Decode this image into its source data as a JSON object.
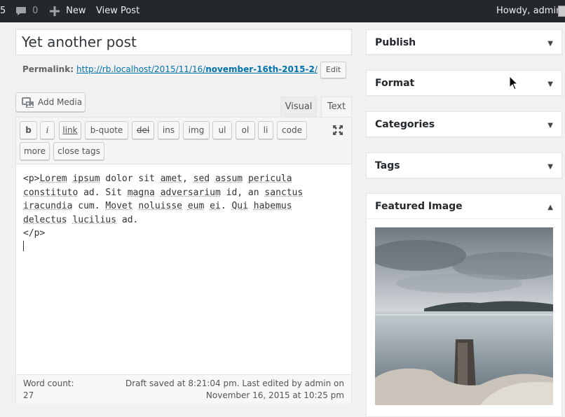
{
  "adminbar": {
    "partial_count": "5",
    "comments_count": "0",
    "new_label": "New",
    "view_post_label": "View Post",
    "howdy": "Howdy, admin"
  },
  "post": {
    "title": "Yet another post",
    "permalink_label": "Permalink:",
    "permalink_base": "http://rb.localhost/2015/11/16/",
    "permalink_slug": "november-16th-2015-2",
    "permalink_trail": "/",
    "edit_label": "Edit"
  },
  "editor": {
    "add_media_label": "Add Media",
    "tabs": {
      "visual": "Visual",
      "text": "Text"
    },
    "quicktags": {
      "b": "b",
      "i": "i",
      "link": "link",
      "bquote": "b-quote",
      "del": "del",
      "ins": "ins",
      "img": "img",
      "ul": "ul",
      "ol": "ol",
      "li": "li",
      "code": "code",
      "more": "more",
      "close": "close tags"
    },
    "content": {
      "open_tag": "<p>",
      "w1": "Lorem",
      "w2": "ipsum",
      "t1": " dolor sit ",
      "w3": "amet",
      "t2": ", ",
      "w4": "sed",
      "t3": " ",
      "w5": "assum",
      "t4": " ",
      "w6": "pericula",
      "w7": "constituto",
      "t5": " ad. Sit ",
      "w8": "magna",
      "t6": " ",
      "w9": "adversarium",
      "t7": " id, an ",
      "w10": "sanctus",
      "w11": "iracundia",
      "t8": " cum. ",
      "w12": "Movet",
      "t9": " ",
      "w13": "noluisse",
      "t10": " ",
      "w14": "eum",
      "t11": " ",
      "w15": "ei",
      "t12": ". ",
      "w16": "Qui",
      "t13": " ",
      "w17": "habemus",
      "w18": "delectus",
      "t14": " ",
      "w19": "lucilius",
      "t15": " ad.",
      "close_tag": "</p>"
    },
    "word_count": "Word count: 27",
    "draft_status": "Draft saved at 8:21:04 pm. Last edited by admin on November 16, 2015 at 10:25 pm"
  },
  "sidebar": {
    "publish": "Publish",
    "format": "Format",
    "categories": "Categories",
    "tags": "Tags",
    "featured_image": "Featured Image"
  },
  "icons": {
    "comments": "comment-bubble-icon",
    "new": "plus-icon",
    "add_media": "media-icon",
    "fullscreen": "fullscreen-icon",
    "collapse": "triangle-down-icon",
    "expand": "triangle-up-icon",
    "pointer": "mouse-cursor-icon"
  },
  "colors": {
    "adminbar": "#23282d",
    "link": "#0073aa",
    "background": "#f1f1f1"
  }
}
